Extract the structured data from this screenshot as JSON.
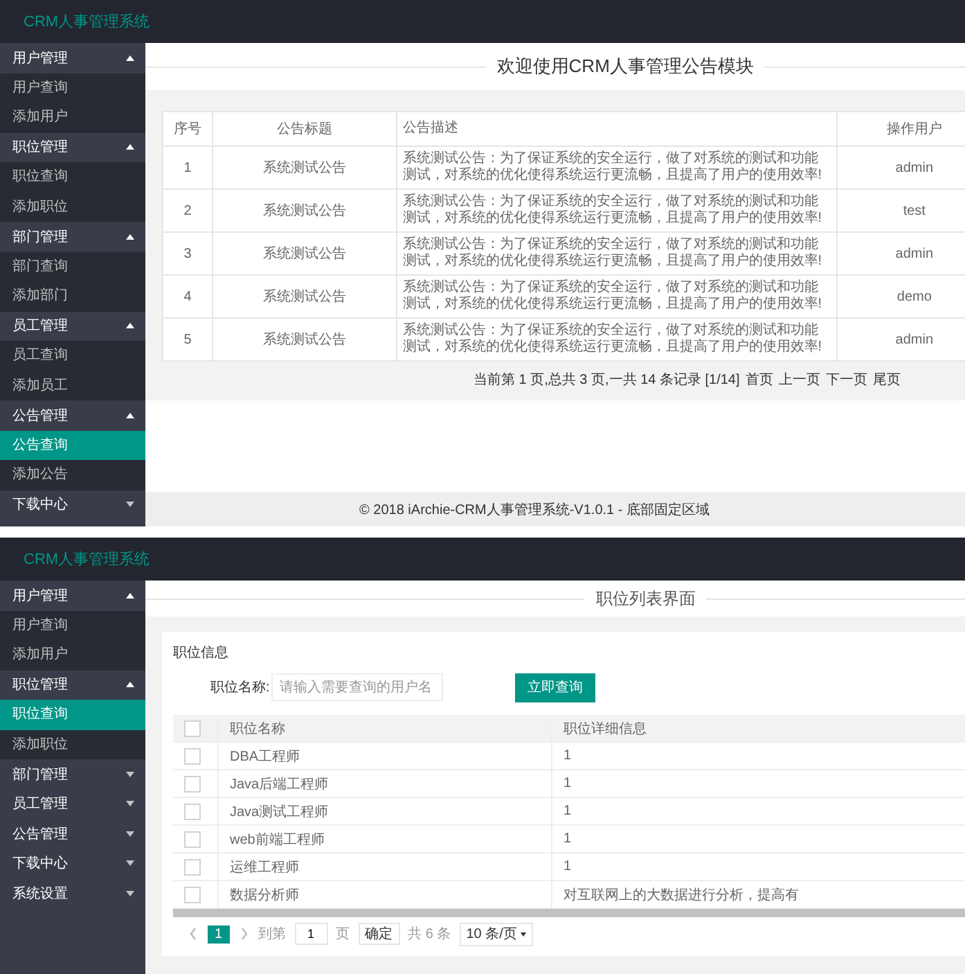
{
  "screens": [
    {
      "header": {
        "logo": "CRM人事管理系统"
      },
      "sidebar": [
        {
          "label": "用户管理",
          "expanded": true,
          "children": [
            {
              "label": "用户查询",
              "selected": false
            },
            {
              "label": "添加用户",
              "selected": false
            }
          ]
        },
        {
          "label": "职位管理",
          "expanded": true,
          "children": [
            {
              "label": "职位查询",
              "selected": false
            },
            {
              "label": "添加职位",
              "selected": false
            }
          ]
        },
        {
          "label": "部门管理",
          "expanded": true,
          "children": [
            {
              "label": "部门查询",
              "selected": false
            },
            {
              "label": "添加部门",
              "selected": false
            }
          ]
        },
        {
          "label": "员工管理",
          "expanded": true,
          "children": [
            {
              "label": "员工查询",
              "selected": false
            },
            {
              "label": "添加员工",
              "selected": false
            }
          ]
        },
        {
          "label": "公告管理",
          "expanded": true,
          "children": [
            {
              "label": "公告查询",
              "selected": true
            },
            {
              "label": "添加公告",
              "selected": false
            }
          ]
        },
        {
          "label": "下载中心",
          "expanded": false
        }
      ],
      "content": {
        "kind": "notice",
        "title": "欢迎使用CRM人事管理公告模块",
        "table": {
          "columns": [
            "序号",
            "公告标题",
            "公告描述",
            "操作用户"
          ],
          "rows": [
            {
              "cells": [
                "1",
                "系统测试公告",
                "系统测试公告：为了保证系统的安全运行，做了对系统的测试和功能测试，对系统的优化使得系统运行更流畅，且提高了用户的使用效率!",
                "admin"
              ]
            },
            {
              "cells": [
                "2",
                "系统测试公告",
                "系统测试公告：为了保证系统的安全运行，做了对系统的测试和功能测试，对系统的优化使得系统运行更流畅，且提高了用户的使用效率!",
                "test"
              ]
            },
            {
              "cells": [
                "3",
                "系统测试公告",
                "系统测试公告：为了保证系统的安全运行，做了对系统的测试和功能测试，对系统的优化使得系统运行更流畅，且提高了用户的使用效率!",
                "admin"
              ]
            },
            {
              "cells": [
                "4",
                "系统测试公告",
                "系统测试公告：为了保证系统的安全运行，做了对系统的测试和功能测试，对系统的优化使得系统运行更流畅，且提高了用户的使用效率!",
                "demo"
              ]
            },
            {
              "cells": [
                "5",
                "系统测试公告",
                "系统测试公告：为了保证系统的安全运行，做了对系统的测试和功能测试，对系统的优化使得系统运行更流畅，且提高了用户的使用效率!",
                "admin"
              ]
            }
          ]
        },
        "pagination": {
          "status": "当前第 1 页,总共 3 页,一共 14 条记录 [1/14]",
          "links": [
            "首页",
            "上一页",
            "下一页",
            "尾页"
          ]
        },
        "footer": "© 2018 iArchie-CRM人事管理系统-V1.0.1 - 底部固定区域"
      }
    },
    {
      "header": {
        "logo": "CRM人事管理系统"
      },
      "sidebar": [
        {
          "label": "用户管理",
          "expanded": true,
          "children": [
            {
              "label": "用户查询",
              "selected": false
            },
            {
              "label": "添加用户",
              "selected": false
            }
          ]
        },
        {
          "label": "职位管理",
          "expanded": true,
          "children": [
            {
              "label": "职位查询",
              "selected": true
            },
            {
              "label": "添加职位",
              "selected": false
            }
          ]
        },
        {
          "label": "部门管理",
          "expanded": false
        },
        {
          "label": "员工管理",
          "expanded": false
        },
        {
          "label": "公告管理",
          "expanded": false
        },
        {
          "label": "下载中心",
          "expanded": false
        },
        {
          "label": "系统设置",
          "expanded": false
        }
      ],
      "content": {
        "kind": "positions",
        "title": "职位列表界面",
        "card_title": "职位信息",
        "search": {
          "label": "职位名称:",
          "placeholder": "请输入需要查询的用户名",
          "button": "立即查询"
        },
        "table": {
          "header_checked": false,
          "columns": [
            "职位名称",
            "职位详细信息"
          ],
          "rows": [
            {
              "checked": false,
              "cells": [
                "DBA工程师",
                "1"
              ]
            },
            {
              "checked": false,
              "cells": [
                "Java后端工程师",
                "1"
              ]
            },
            {
              "checked": false,
              "cells": [
                "Java测试工程师",
                "1"
              ]
            },
            {
              "checked": false,
              "cells": [
                "web前端工程师",
                "1"
              ]
            },
            {
              "checked": false,
              "cells": [
                "运维工程师",
                "1"
              ]
            },
            {
              "checked": false,
              "cells": [
                "数据分析师",
                "对互联网上的大数据进行分析，提高有"
              ]
            }
          ]
        },
        "pagination": {
          "pages": [
            {
              "label": "1",
              "selected": true
            }
          ],
          "goto_label": "到第",
          "goto_value": "1",
          "page_unit": "页",
          "confirm": "确定",
          "total": "共 6 条",
          "page_size": "10 条/页"
        }
      }
    }
  ]
}
